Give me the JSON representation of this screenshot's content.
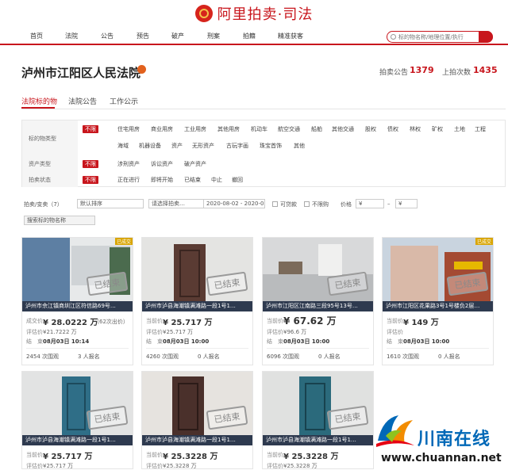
{
  "header": {
    "logo_text": "阿里拍卖·司法"
  },
  "nav": {
    "items": [
      "首页",
      "法院",
      "公告",
      "预告",
      "破产",
      "刑案",
      "拍籍",
      "精准获客"
    ]
  },
  "search": {
    "placeholder": "标的物名称/地理位置/执行"
  },
  "court": {
    "name": "泸州市江阳区人民法院",
    "notice_label": "拍卖公告",
    "notice_count": "1379",
    "auction_label": "上拍次数",
    "auction_count": "1435"
  },
  "tabs": [
    "法院标的物",
    "法院公告",
    "工作公示"
  ],
  "filter": {
    "rows": [
      {
        "label": "标的物类型",
        "selected": "不限",
        "options": [
          "住宅用房",
          "商业用房",
          "工业用房",
          "其他用房",
          "机动车",
          "航空交通",
          "船舶",
          "其他交通",
          "股权",
          "债权",
          "林权",
          "矿权",
          "土地",
          "工程",
          "海域",
          "机器设备",
          "资产",
          "无形资产",
          "古玩字画",
          "珠宝首饰",
          "其他"
        ]
      },
      {
        "label": "资产类型",
        "selected": "不限",
        "options": [
          "涉刑资产",
          "诉讼资产",
          "破产资产"
        ]
      },
      {
        "label": "拍卖状态",
        "selected": "不限",
        "options": [
          "正在进行",
          "即将开始",
          "已结束",
          "中止",
          "撤回"
        ]
      }
    ]
  },
  "toolbar": {
    "type_select": "拍卖/变卖（7）",
    "sort_select": "默认排序",
    "city_select": "请选择拍卖…",
    "date_range": "2020-08-02 - 2020-08",
    "loan_label": "可贷款",
    "nolimit_label": "不限购",
    "price_label": "价格",
    "price_min": "¥",
    "price_sep": "–",
    "price_max": "¥",
    "name_search": "搜索标的物名称"
  },
  "cards": [
    {
      "title": "泸州市佘江镇商圳江区符信路69号…",
      "stamp": "已结束",
      "badge": "已成交",
      "l1": "成交价",
      "p1": "¥ 28.0222 万",
      "extra": "（62次出价）",
      "l2": "评估价",
      "p2": "¥21.7222 万",
      "l3": "结　束",
      "p3": "08月03日 10:14",
      "views": "2454 次围观",
      "signups": "3 人报名"
    },
    {
      "title": "泸州市泸县海潮镇满滩路一段1号1…",
      "stamp": "已结束",
      "badge": "",
      "l1": "当前价",
      "p1": "¥ 25.717 万",
      "extra": "",
      "l2": "评估价",
      "p2": "¥25.717 万",
      "l3": "结　束",
      "p3": "08月03日 10:00",
      "views": "4260 次围观",
      "signups": "0 人报名"
    },
    {
      "title": "泸州市江阳区江南路三段95号13号…",
      "stamp": "已结束",
      "badge": "",
      "l1": "当前价",
      "p1": "¥ 67.62 万",
      "extra": "",
      "l2": "评估价",
      "p2": "¥96.6 万",
      "l3": "结　束",
      "p3": "08月03日 10:00",
      "views": "6096 次围观",
      "signups": "0 人报名"
    },
    {
      "title": "泸州市江阳区花果路3号1号楼负2层…",
      "stamp": "已结束",
      "badge": "已成交",
      "l1": "当前价",
      "p1": "¥ 149 万",
      "extra": "",
      "l2": "评估价",
      "p2": "",
      "l3": "结　束",
      "p3": "08月03日 10:00",
      "views": "1610 次围观",
      "signups": "0 人报名"
    },
    {
      "title": "泸州市泸县海潮镇满滩路一段1号1…",
      "stamp": "已结束",
      "badge": "",
      "l1": "当前价",
      "p1": "¥ 25.717 万",
      "extra": "",
      "l2": "评估价",
      "p2": "¥25.717 万",
      "l3": "",
      "p3": "",
      "views": "",
      "signups": ""
    },
    {
      "title": "泸州市泸县海潮镇满滩路一段1号1…",
      "stamp": "已结束",
      "badge": "",
      "l1": "当前价",
      "p1": "¥ 25.3228 万",
      "extra": "",
      "l2": "评估价",
      "p2": "¥25.3228 万",
      "l3": "",
      "p3": "",
      "views": "",
      "signups": ""
    },
    {
      "title": "泸州市泸县海潮镇满滩路一段1号1…",
      "stamp": "已结束",
      "badge": "",
      "l1": "当前价",
      "p1": "¥ 25.3228 万",
      "extra": "",
      "l2": "评估价",
      "p2": "¥25.3228 万",
      "l3": "",
      "p3": "",
      "views": "",
      "signups": ""
    }
  ],
  "watermark": {
    "cn": "川南在线",
    "url": "www.chuannan.net"
  }
}
